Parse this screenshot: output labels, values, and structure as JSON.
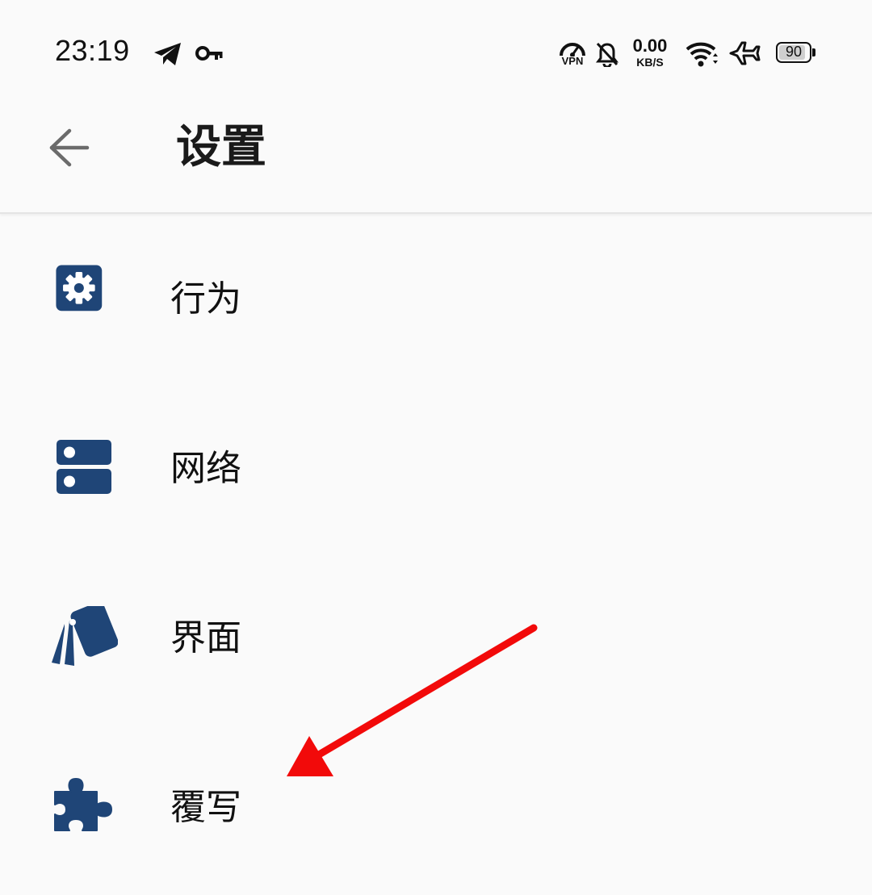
{
  "status_bar": {
    "time": "23:19",
    "icons": [
      "telegram-icon",
      "vpn-key-icon",
      "vpn-speed-icon",
      "bell-off-icon",
      "wifi-icon",
      "airplane-icon"
    ],
    "vpn_label": "VPN",
    "net_speed_value": "0.00",
    "net_speed_unit": "KB/S",
    "battery_level": "90",
    "battery_fraction": 0.9
  },
  "app_bar": {
    "title": "设置",
    "back_icon": "arrow-back-icon"
  },
  "settings": {
    "items": [
      {
        "label": "行为",
        "icon": "gear-icon"
      },
      {
        "label": "网络",
        "icon": "server-icon"
      },
      {
        "label": "界面",
        "icon": "cards-icon"
      },
      {
        "label": "覆写",
        "icon": "puzzle-icon"
      }
    ]
  },
  "colors": {
    "icon_accent": "#1f4577",
    "annotation_arrow": "#f20a0a",
    "background": "#fafafa",
    "text": "#111111"
  }
}
